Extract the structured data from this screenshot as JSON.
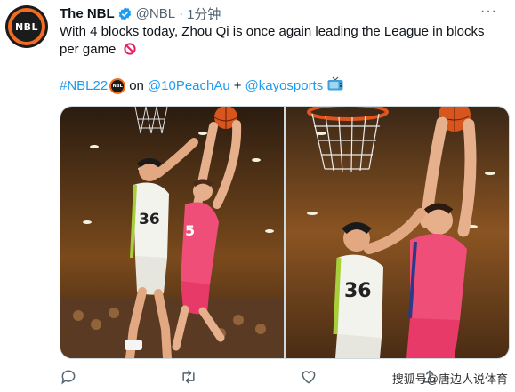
{
  "tweet": {
    "author_name": "The NBL",
    "handle": "@NBL",
    "separator": "·",
    "time": "1分钟",
    "more_label": "···",
    "text": "With 4 blocks today, Zhou Qi is once again leading the League in blocks per game",
    "hashtag": "#NBL22",
    "on_word": "on",
    "mention_1": "@10PeachAu",
    "plus": "+",
    "mention_2": "@kayosports",
    "avatar_text": "NBL",
    "mini_logo_text": "NBL"
  },
  "images": [
    {
      "jersey_front": "36",
      "jersey_back": "5"
    },
    {
      "jersey_front": "36"
    }
  ],
  "actions": [
    "reply-icon",
    "retweet-icon",
    "like-icon",
    "share-icon"
  ],
  "watermark": "搜狐号@唐边人说体育",
  "colors": {
    "brand_orange": "#f26c21",
    "link": "#1d9bf0",
    "verified": "#1d9bf0",
    "secondary": "#536471"
  }
}
